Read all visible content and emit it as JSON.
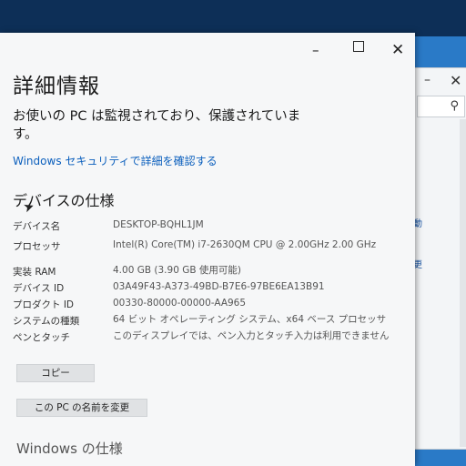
{
  "window": {
    "title": "詳細情報",
    "minimize": "–",
    "close": "✕"
  },
  "status": {
    "message": "お使いの PC は監視されており、保護されています。",
    "link": "Windows セキュリティで詳細を確認する"
  },
  "device_specs": {
    "heading": "デバイスの仕様",
    "rows": [
      {
        "label": "デバイス名",
        "value": "DESKTOP-BQHL1JM"
      },
      {
        "label": "プロセッサ",
        "value": "Intel(R) Core(TM) i7-2630QM CPU @ 2.00GHz   2.00 GHz"
      },
      {
        "label": "実装 RAM",
        "value": "4.00 GB (3.90 GB 使用可能)"
      },
      {
        "label": "デバイス ID",
        "value": "03A49F43-A373-49BD-B7E6-97BE6EA13B91"
      },
      {
        "label": "プロダクト ID",
        "value": "00330-80000-00000-AA965"
      },
      {
        "label": "システムの種類",
        "value": "64 ビット オペレーティング システム、x64 ベース プロセッサ"
      },
      {
        "label": "ペンとタッチ",
        "value": "このディスプレイでは、ペン入力とタッチ入力は利用できません"
      }
    ],
    "copy_button": "コピー",
    "rename_button": "この PC の名前を変更"
  },
  "windows_specs": {
    "heading": "Windows の仕様"
  },
  "background_window": {
    "minimize": "–",
    "close": "✕",
    "search_icon": "⚲",
    "fragment1": "動",
    "fragment2": "更"
  }
}
